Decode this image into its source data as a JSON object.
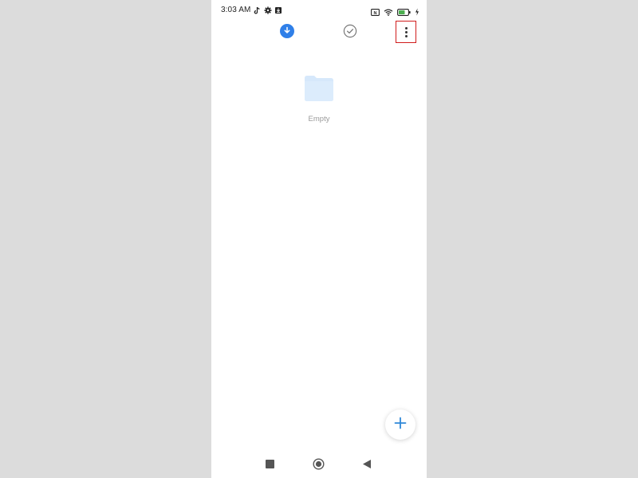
{
  "status_bar": {
    "time": "3:03 AM",
    "icons": [
      "tiktok-icon",
      "gear-icon",
      "download-notification-icon",
      "nfc-icon",
      "wifi-icon",
      "battery-icon",
      "charging-bolt-icon"
    ],
    "battery_color": "#4caf50"
  },
  "toolbar": {
    "tabs": [
      {
        "icon": "download-arrow-icon",
        "active": true,
        "color": "#2f7fe8"
      },
      {
        "icon": "check-circle-icon",
        "active": false
      }
    ],
    "menu_icon": "more-vert-icon",
    "highlight_color": "#d01c1c"
  },
  "empty_state": {
    "icon": "folder-icon",
    "label": "Empty",
    "folder_color": "#d6e8fb"
  },
  "fab": {
    "icon": "plus-icon",
    "color": "#2f88d8"
  },
  "navigation": {
    "icons": [
      "recents-square-icon",
      "home-circle-icon",
      "back-triangle-icon"
    ]
  }
}
